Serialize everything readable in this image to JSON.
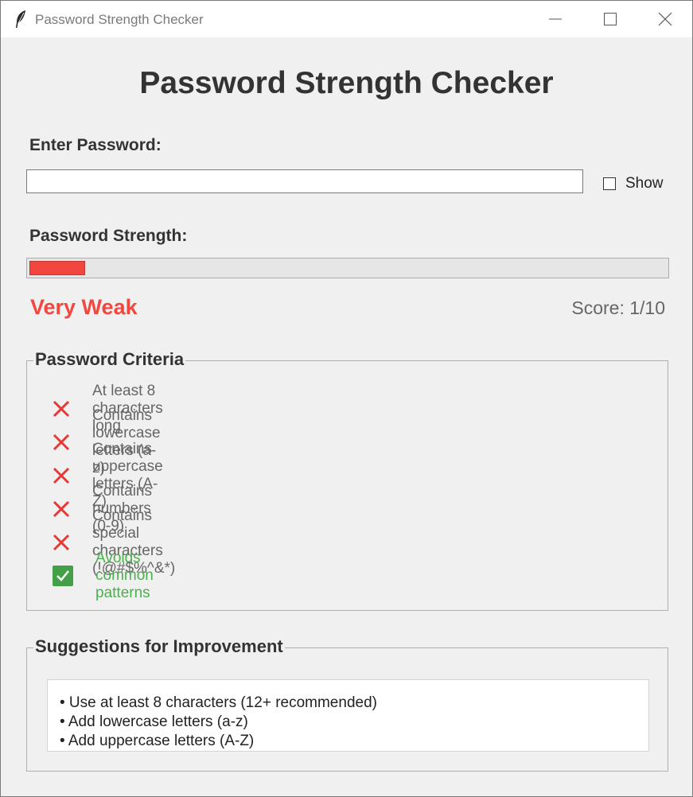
{
  "window": {
    "title": "Password Strength Checker",
    "controls": [
      "minimize-icon",
      "maximize-icon",
      "close-icon"
    ]
  },
  "header": {
    "title": "Password Strength Checker"
  },
  "password": {
    "label": "Enter Password:",
    "value": "",
    "show_label": "Show",
    "show_checked": false
  },
  "strength": {
    "label": "Password Strength:",
    "level_text": "Very Weak",
    "level_color": "#f2473f",
    "score_text": "Score: 1/10",
    "progress_fraction": 0.1
  },
  "criteria": {
    "title": "Password Criteria",
    "items": [
      {
        "label": "At least 8 characters long",
        "met": false
      },
      {
        "label": "Contains lowercase letters (a-z)",
        "met": false
      },
      {
        "label": "Contains uppercase letters (A-Z)",
        "met": false
      },
      {
        "label": "Contains numbers (0-9)",
        "met": false
      },
      {
        "label": "Contains special characters (!@#$%^&*)",
        "met": false
      },
      {
        "label": "Avoids common patterns",
        "met": true
      }
    ],
    "colors": {
      "fail_icon": "#e53935",
      "fail_text": "#666666",
      "pass_icon": "#43a047",
      "pass_text": "#4caf50"
    }
  },
  "suggestions": {
    "title": "Suggestions for Improvement",
    "lines": [
      "• Use at least 8 characters (12+ recommended)",
      "• Add lowercase letters (a-z)",
      "• Add uppercase letters (A-Z)"
    ]
  }
}
